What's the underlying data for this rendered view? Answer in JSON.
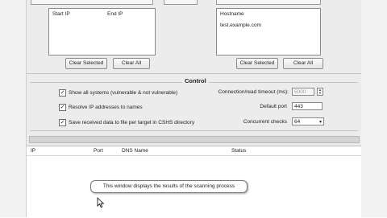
{
  "ip_range": {
    "start_ip_header": "Start IP",
    "end_ip_header": "End IP",
    "clear_selected_label": "Clear Selected",
    "clear_all_label": "Clear All"
  },
  "hostnames": {
    "header": "Hostname",
    "items": [
      "test.example.com"
    ],
    "clear_selected_label": "Clear Selected",
    "clear_all_label": "Clear All"
  },
  "control": {
    "title": "Control",
    "checkboxes": [
      {
        "label": "Show all systems (vulnerable & not vulnerable)",
        "checked": true
      },
      {
        "label": "Resolve IP addresses to names",
        "checked": true
      },
      {
        "label": "Save received data to file per target in CSHS directory",
        "checked": true
      }
    ],
    "timeout_label": "Connection/read timeout (ms):",
    "timeout_value": "5000",
    "port_label": "Default port",
    "port_value": "443",
    "concurrent_label": "Concurrent checks",
    "concurrent_value": "64"
  },
  "results": {
    "columns": [
      "IP",
      "Port",
      "DNS Name",
      "Status"
    ],
    "tooltip": "This window displays the results of the scanning process"
  },
  "colors": {
    "panel_bg": "#ececec",
    "border": "#8a8a8a"
  }
}
